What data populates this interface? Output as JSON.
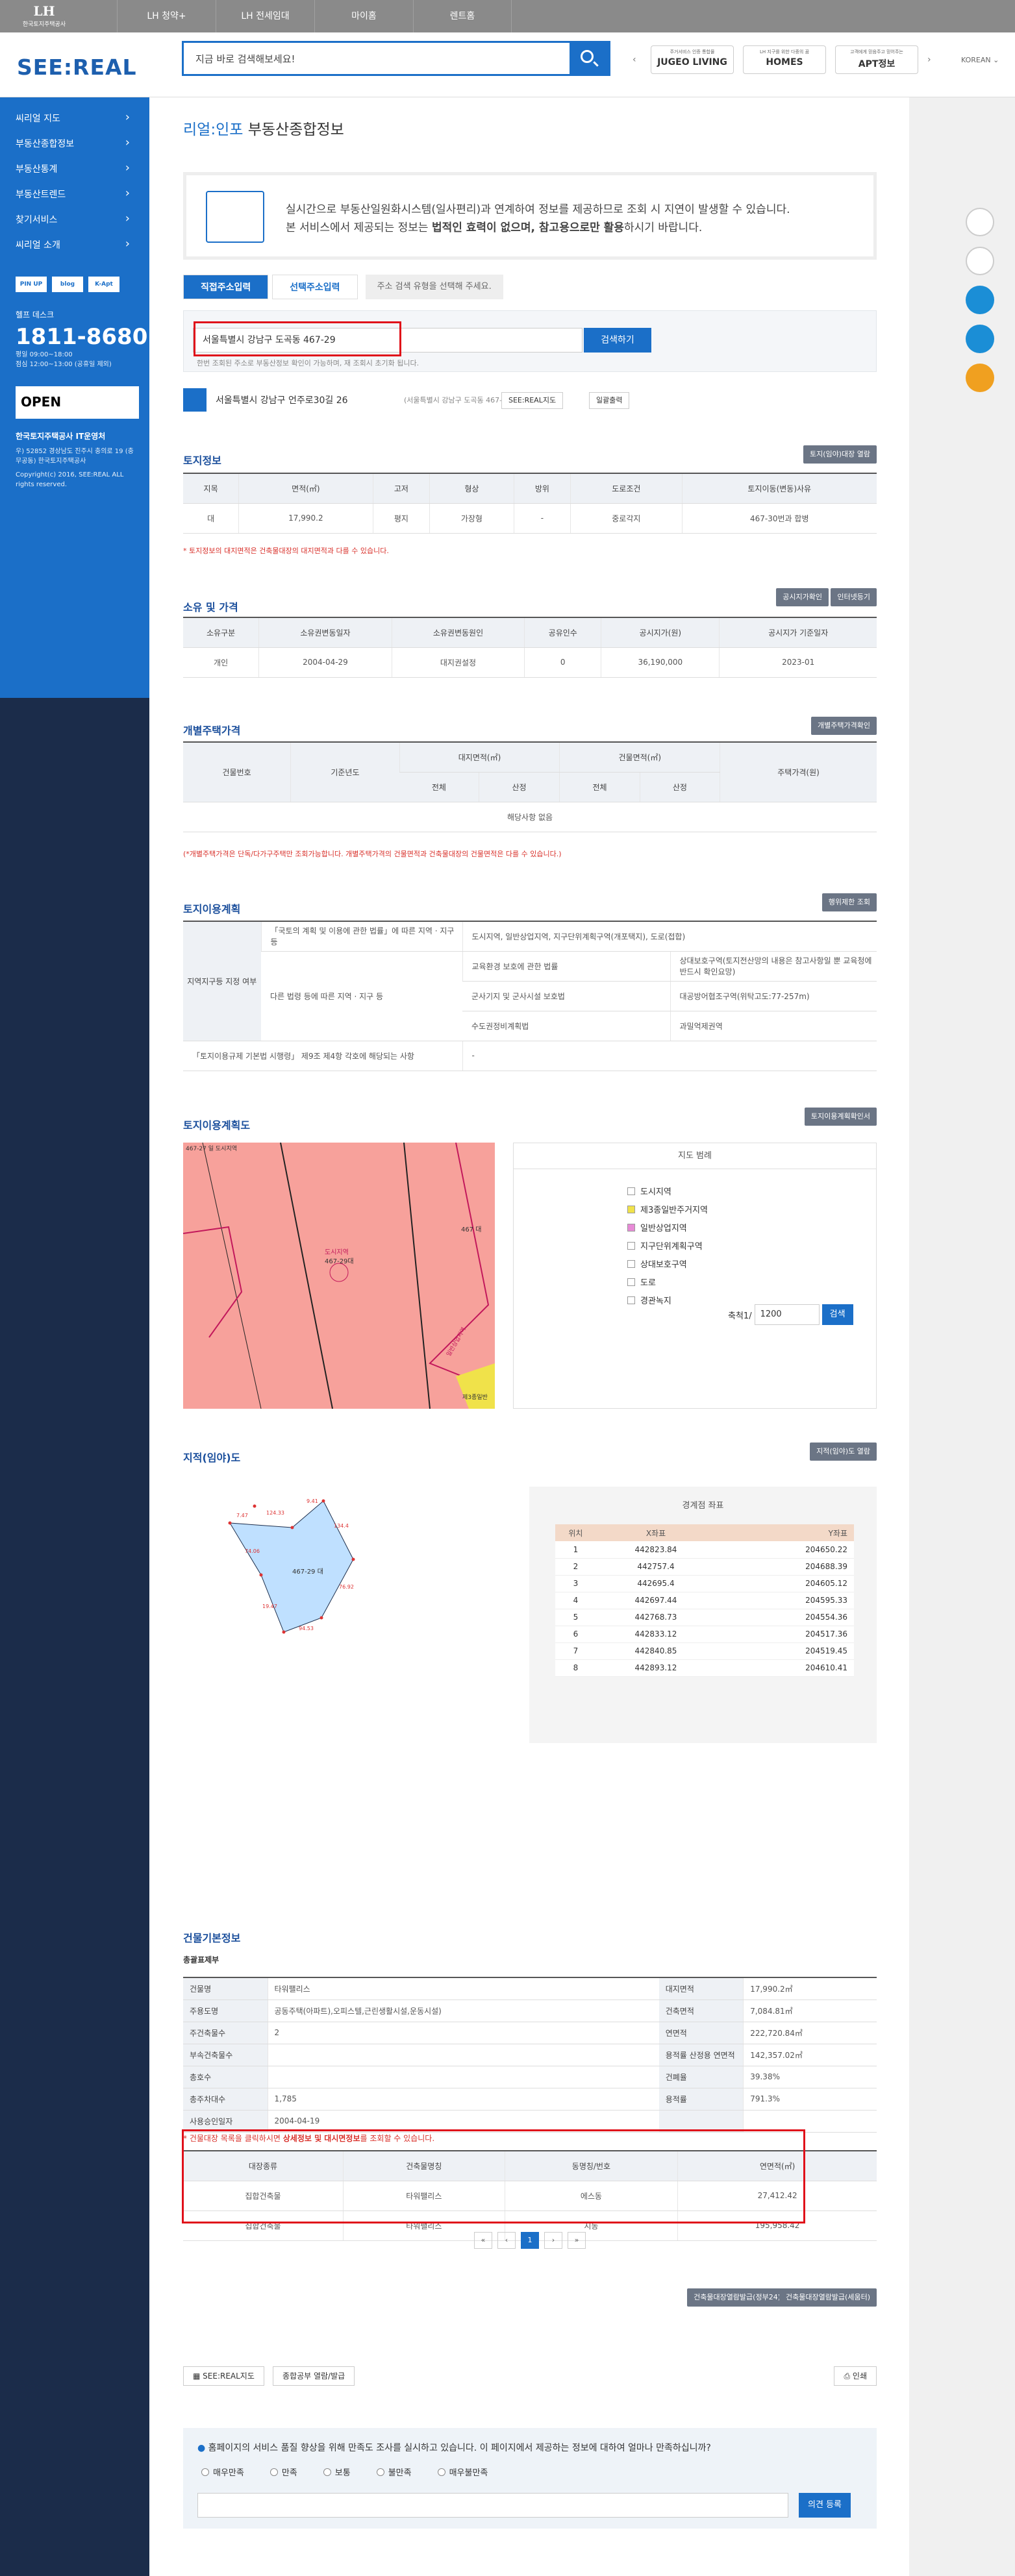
{
  "top": {
    "brand_small": "한국토지주택공사",
    "brand": "LH",
    "tabs": [
      "LH 청약+",
      "LH 전세임대",
      "마이홈",
      "렌트홈"
    ]
  },
  "header": {
    "logo": "SEE:REAL",
    "search_placeholder": "지금 바로 검색해보세요!",
    "banners": [
      {
        "small": "주거서비스 인증 통합몰",
        "name": "JUGEO LIVING"
      },
      {
        "small": "LH 지구를 위한 다중의 꿈",
        "name": "HOMES"
      },
      {
        "small": "고객에게 믿음주고 믿어주는",
        "name": "APT정보"
      }
    ],
    "lang": "KOREAN"
  },
  "sidebar": {
    "items": [
      "씨리얼 지도",
      "부동산종합정보",
      "부동산통계",
      "부동산트렌드",
      "찾기서비스",
      "씨리얼 소개"
    ],
    "logos": [
      "PIN UP",
      "blog",
      "K-Apt"
    ],
    "help_title": "헬프 데스크",
    "phone": "1811-8680",
    "hours": [
      "평일 09:00~18:00",
      "점심 12:00~13:00 (공휴일 제외)"
    ],
    "open": "OPEN",
    "org": "한국토지주택공사 IT운영처",
    "addr": "우) 52852 경상남도 진주시 충의로 19 (충무공동) 한국토지주택공사",
    "copy": "Copyright(c) 2016, SEE:REAL ALL rights reserved."
  },
  "page": {
    "title_a": "리얼:인포",
    "title_b": " 부동산종합정보",
    "notice1": "실시간으로 부동산일원화시스템(일사편리)과 연계하여 정보를 제공하므로 조회 시 지연이 발생할 수 있습니다.",
    "notice2a": "본 서비스에서 제공되는 정보는 ",
    "notice2b": "법적인 효력이 없으며, 참고용으로만 활용",
    "notice2c": "하시기 바랍니다.",
    "tab1": "직접주소입력",
    "tab2": "선택주소입력",
    "tab_hint": "주소 검색 유형을 선택해 주세요.",
    "address": "서울특별시 강남구 도곡동 467-29",
    "search_btn": "검색하기",
    "addr_hint": "한번 조회된 주소로 부동산정보 확인이 가능하며, 재 조회시 초기화 됩니다.",
    "result_addr": "서울특별시 강남구 언주로30길 26",
    "result_sub": "(서울특별시 강남구 도곡동 467-29)",
    "map_btn": "SEE:REAL지도",
    "print_btn": "일괄출력"
  },
  "land": {
    "title": "토지정보",
    "btn": "토지(임야)대장 열람",
    "headers": [
      "지목",
      "면적(㎡)",
      "고저",
      "형상",
      "방위",
      "도로조건",
      "토지이동(변동)사유"
    ],
    "row": [
      "대",
      "17,990.2",
      "평지",
      "가장형",
      "-",
      "중로각지",
      "467-30번과 합병"
    ],
    "note": "* 토지정보의 대지면적은 건축물대장의 대지면적과 다를 수 있습니다."
  },
  "owner": {
    "title": "소유 및 가격",
    "btn1": "공시지가확인",
    "btn2": "인터넷등기",
    "headers": [
      "소유구분",
      "소유권변동일자",
      "소유권변동원인",
      "공유인수",
      "공시지가(원)",
      "공시지가 기준일자"
    ],
    "row": [
      "개인",
      "2004-04-29",
      "대지권설정",
      "0",
      "36,190,000",
      "2023-01"
    ]
  },
  "house": {
    "title": "개별주택가격",
    "btn": "개별주택가격확인",
    "h1": [
      "건물번호",
      "기준년도",
      "대지면적(㎡)",
      "건물면적(㎡)",
      "주택가격(원)"
    ],
    "h2": [
      "전체",
      "산정",
      "전체",
      "산정"
    ],
    "empty": "해당사항 없음",
    "note": "(*개별주택가격은 단독/다가구주택만 조회가능합니다. 개별주택가격의 건물면적과 건축물대장의 건물면적은 다를 수 있습니다.)"
  },
  "plan": {
    "title": "토지이용계획",
    "btn": "행위제한 조회",
    "rowhead": "지역지구등 지정 여부",
    "r1a": "「국토의 계획 및 이용에 관한 법률」에 따른 지역 · 지구 등",
    "r1b": "도시지역, 일반상업지역, 지구단위계획구역(개포택지), 도로(접합)",
    "r2a": "다른 법령 등에 따른 지역 · 지구 등",
    "r2b1": "교육환경 보호에 관한 법률",
    "r2c1": "상대보호구역(토지전산망의 내용은 참고사항일 뿐 교육청에 반드시 확인요망)",
    "r2b2": "군사기지 및 군사시설 보호법",
    "r2c2": "대공방어협조구역(위탁고도:77-257m)",
    "r2b3": "수도권정비계획법",
    "r2c3": "과밀억제권역",
    "r3a": "「토지이용규제 기본법 시행령」 제9조 제4항 각호에 해당되는 사항",
    "r3b": "-"
  },
  "planmap": {
    "title": "토지이용계획도",
    "btn": "토지이용계획확인서",
    "labels": [
      "467-27 일 도시지역",
      "467 대",
      "도시지역",
      "467-29대",
      "일반상업지역",
      "제3종일반"
    ],
    "legend_title": "지도 범례",
    "legend": [
      "도시지역",
      "제3종일반주거지역",
      "일반상업지역",
      "지구단위계획구역",
      "상대보호구역",
      "도로",
      "경관녹지"
    ],
    "legend_colors": [
      "#ffffff",
      "#f0e24a",
      "#e78ad6",
      "#ffffff",
      "#ffffff",
      "#ffffff",
      "#ffffff"
    ],
    "scale_label": "축척1/",
    "scale": "1200",
    "scale_btn": "검색"
  },
  "cadastral": {
    "title": "지적(임야)도",
    "btn": "지적(임야)도 열람",
    "parcel": "467-29 대",
    "lengths": [
      "124.33",
      "74.06",
      "76.92",
      "94.53",
      "134.4",
      "9.41",
      "19.47",
      "7.47"
    ],
    "coord_title": "경계점 좌표",
    "headers": [
      "위치",
      "X좌표",
      "Y좌표"
    ],
    "rows": [
      [
        "1",
        "442823.84",
        "204650.22"
      ],
      [
        "2",
        "442757.4",
        "204688.39"
      ],
      [
        "3",
        "442695.4",
        "204605.12"
      ],
      [
        "4",
        "442697.44",
        "204595.33"
      ],
      [
        "5",
        "442768.73",
        "204554.36"
      ],
      [
        "6",
        "442833.12",
        "204517.36"
      ],
      [
        "7",
        "442840.85",
        "204519.45"
      ],
      [
        "8",
        "442893.12",
        "204610.41"
      ]
    ]
  },
  "building": {
    "title": "건물기본정보",
    "subtitle": "총괄표제부",
    "rows": [
      [
        "건물명",
        "타워팰리스",
        "대지면적",
        "17,990.2㎡"
      ],
      [
        "주용도명",
        "공동주택(아파트),오피스텔,근린생활시설,운동시설)",
        "건축면적",
        "7,084.81㎡"
      ],
      [
        "주건축물수",
        "2",
        "연면적",
        "222,720.84㎡"
      ],
      [
        "부속건축물수",
        "",
        "용적률 산정용 연면적",
        "142,357.02㎡"
      ],
      [
        "총호수",
        "",
        "건폐율",
        "39.38%"
      ],
      [
        "총주차대수",
        "1,785",
        "용적률",
        "791.3%"
      ],
      [
        "사용승인일자",
        "2004-04-19",
        "",
        ""
      ]
    ],
    "note_a": "* 건물대장 목록을 클릭하시면 ",
    "note_b": "상세정보 및 대시면정보",
    "note_c": "를 조회할 수 있습니다.",
    "list_headers": [
      "대장종류",
      "건축물명칭",
      "동명칭/번호",
      "연면적(㎡)"
    ],
    "list_rows": [
      [
        "집합건축물",
        "타워팰리스",
        "에스동",
        "27,412.42"
      ],
      [
        "집합건축물",
        "타워팰리스",
        "지동",
        "195,958.42"
      ]
    ],
    "pages": [
      "«",
      "‹",
      "1",
      "›",
      "»"
    ],
    "btn_a": "건축물대장열람발급(정부24)",
    "btn_b": "건축물대장열람발급(세움터)"
  },
  "footerbtns": {
    "map": "SEE:REAL지도",
    "report": "종합공부 열람/발급",
    "print": "인쇄"
  },
  "survey": {
    "q": "홈페이지의 서비스 품질 향상을 위해 만족도 조사를 실시하고 있습니다. 이 페이지에서 제공하는 정보에 대하여 얼마나 만족하십니까?",
    "opts": [
      "매우만족",
      "만족",
      "보통",
      "불만족",
      "매우불만족"
    ],
    "submit": "의견 등록"
  }
}
